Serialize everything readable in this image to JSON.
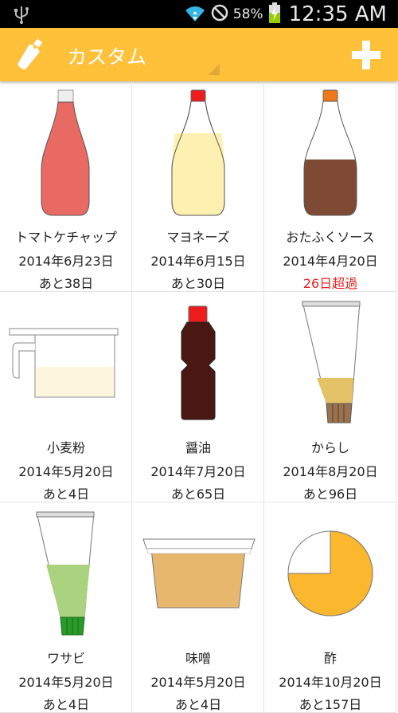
{
  "status": {
    "battery": "58%",
    "time": "12:35 AM"
  },
  "appbar": {
    "title": "カスタム"
  },
  "items": [
    {
      "name": "トマトケチャップ",
      "date": "2014年6月23日",
      "remain": "あと38日"
    },
    {
      "name": "マヨネーズ",
      "date": "2014年6月15日",
      "remain": "あと30日"
    },
    {
      "name": "おたふくソース",
      "date": "2014年4月20日",
      "remain": "26日超過"
    },
    {
      "name": "小麦粉",
      "date": "2014年5月20日",
      "remain": "あと4日"
    },
    {
      "name": "醤油",
      "date": "2014年7月20日",
      "remain": "あと65日"
    },
    {
      "name": "からし",
      "date": "2014年8月20日",
      "remain": "あと96日"
    },
    {
      "name": "ワサビ",
      "date": "2014年5月20日",
      "remain": "あと4日"
    },
    {
      "name": "味噌",
      "date": "2014年5月20日",
      "remain": "あと4日"
    },
    {
      "name": "酢",
      "date": "2014年10月20日",
      "remain": "あと157日"
    }
  ],
  "colors": {
    "accent": "#ffc03a",
    "overdue": "#e62222"
  }
}
